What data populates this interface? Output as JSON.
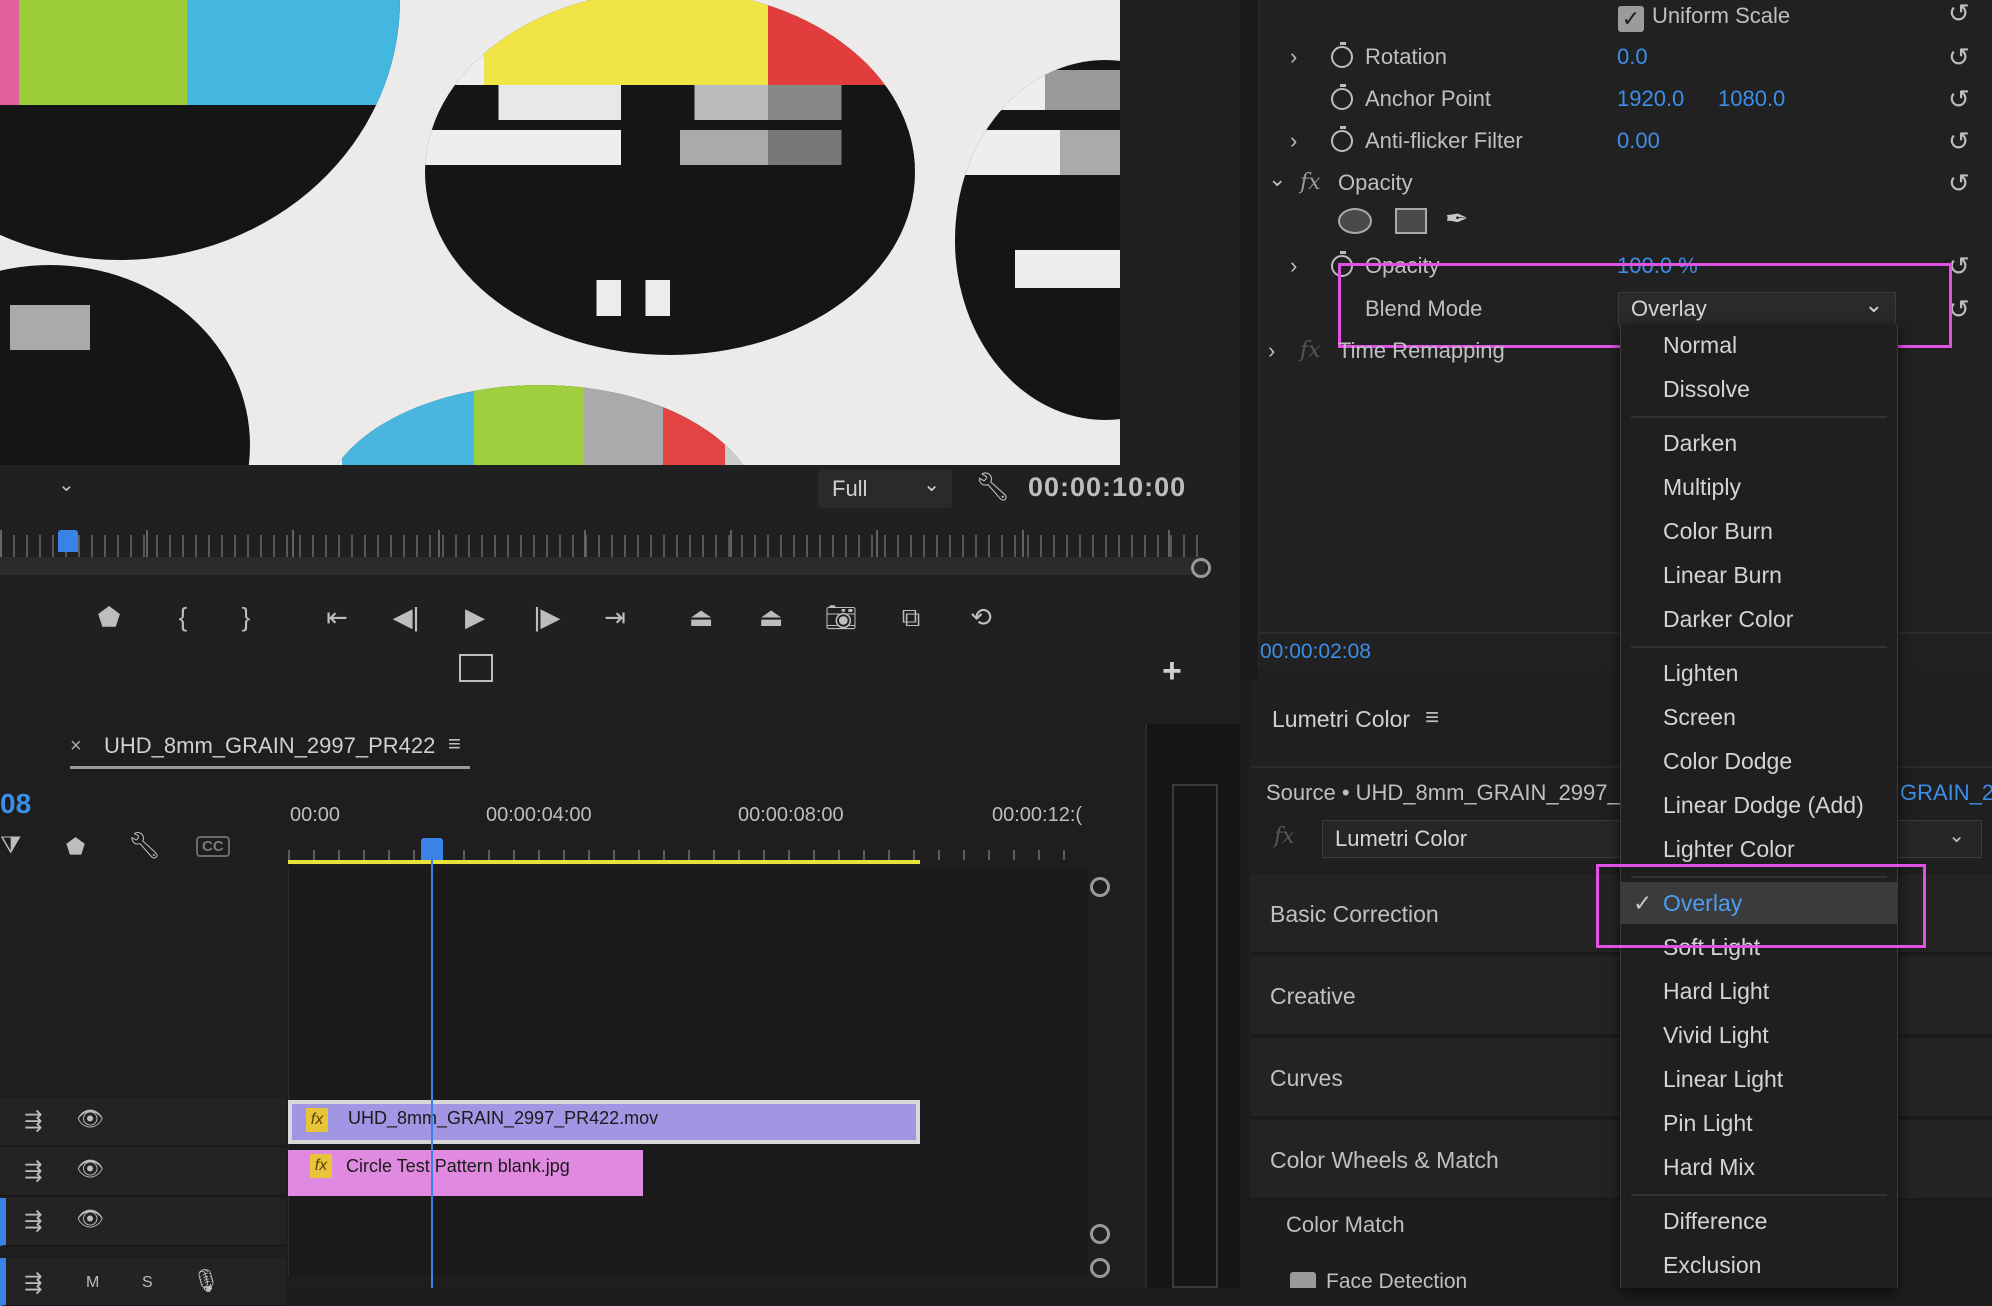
{
  "monitor": {
    "resolution": "Full",
    "timecode": "00:00:10:00",
    "add_button": "+"
  },
  "effect_controls": {
    "uniform_scale": "Uniform Scale",
    "rotation": {
      "label": "Rotation",
      "value": "0.0"
    },
    "anchor_point": {
      "label": "Anchor Point",
      "x": "1920.0",
      "y": "1080.0"
    },
    "anti_flicker": {
      "label": "Anti-flicker Filter",
      "value": "0.00"
    },
    "opacity_group": {
      "label": "Opacity"
    },
    "opacity": {
      "label": "Opacity",
      "value": "100.0 %"
    },
    "blend_mode": {
      "label": "Blend Mode",
      "value": "Overlay"
    },
    "time_remapping": {
      "label": "Time Remapping"
    },
    "fx_symbol": "fx",
    "timecode": "00:00:02:08"
  },
  "timeline": {
    "sequence_name": "UHD_8mm_GRAIN_2997_PR422",
    "timecode_partial": "08",
    "ruler": [
      "00:00",
      "00:00:04:00",
      "00:00:08:00",
      "00:00:12:("
    ],
    "clips": [
      {
        "name": "UHD_8mm_GRAIN_2997_PR422.mov",
        "color": "#a196e3"
      },
      {
        "name": "Circle Test Pattern blank.jpg",
        "color": "#df8ae0"
      }
    ],
    "track_labels": {
      "m": "M",
      "s": "S",
      "cc": "CC"
    }
  },
  "lumetri": {
    "title": "Lumetri Color",
    "source": "Source • UHD_8mm_GRAIN_2997_",
    "source_suffix": "GRAIN_2",
    "effect_select": "Lumetri Color",
    "sections": [
      "Basic Correction",
      "Creative",
      "Curves",
      "Color Wheels & Match"
    ],
    "color_match": "Color Match",
    "face_detection": "Face Detection"
  },
  "blend_menu": {
    "groups": [
      [
        "Normal",
        "Dissolve"
      ],
      [
        "Darken",
        "Multiply",
        "Color Burn",
        "Linear Burn",
        "Darker Color"
      ],
      [
        "Lighten",
        "Screen",
        "Color Dodge",
        "Linear Dodge (Add)",
        "Lighter Color"
      ],
      [
        "Overlay",
        "Soft Light",
        "Hard Light",
        "Vivid Light",
        "Linear Light",
        "Pin Light",
        "Hard Mix"
      ],
      [
        "Difference",
        "Exclusion"
      ]
    ],
    "selected": "Overlay"
  },
  "colors": {
    "accent_blue": "#3d8ee8",
    "highlight": "#e052e6",
    "work_area": "#e8e23a"
  }
}
